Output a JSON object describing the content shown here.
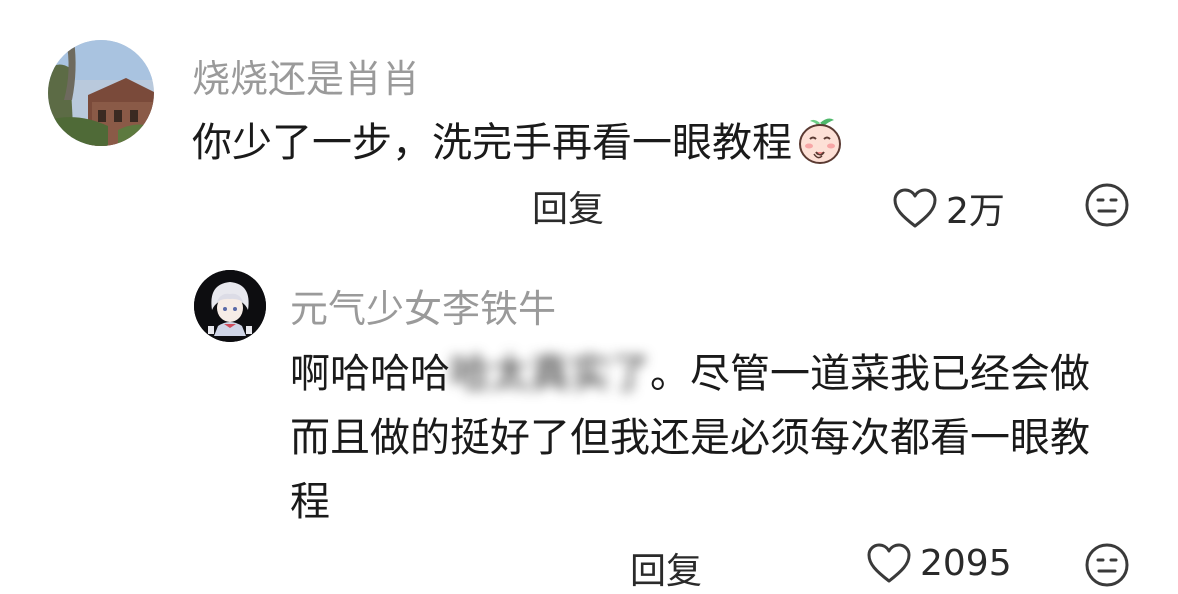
{
  "comments": [
    {
      "username": "烧烧还是肖肖",
      "text": "你少了一步，洗完手再看一眼教程",
      "reply_label": "回复",
      "like_count": "2万",
      "avatar_icon": "landscape-photo-avatar",
      "emoji_icon": "peach-shy-emoji"
    },
    {
      "username": "元气少女李铁牛",
      "text_before": "啊哈哈哈",
      "text_obscured": "哈太真实了",
      "text_after": "。尽管一道菜我已经会做而且做的挺好了但我还是必须每次都看一眼教程",
      "reply_label": "回复",
      "like_count": "2095",
      "avatar_icon": "anime-character-avatar"
    }
  ],
  "icons": {
    "like": "heart-outline-icon",
    "dislike": "meh-face-icon"
  },
  "colors": {
    "username": "#9a9a9a",
    "text": "#1a1a1a",
    "action": "#2a2a2a",
    "icon": "#3a3a3a"
  }
}
